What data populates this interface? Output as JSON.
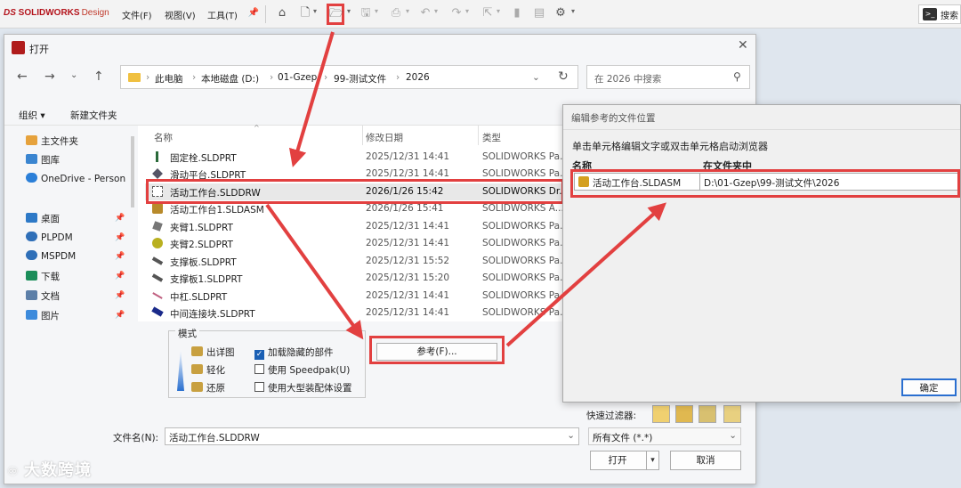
{
  "app": {
    "brand": "SOLIDWORKS",
    "brand_sub": "Design",
    "menus": [
      "文件(F)",
      "视图(V)",
      "工具(T)"
    ],
    "search_placeholder": "搜索"
  },
  "open_dialog": {
    "title": "打开",
    "path": [
      "此电脑",
      "本地磁盘 (D:)",
      "01-Gzep",
      "99-测试文件",
      "2026"
    ],
    "search_placeholder": "在 2026 中搜索",
    "toolbar": {
      "organize": "组织",
      "new_folder": "新建文件夹"
    },
    "nav_items": [
      "主文件夹",
      "图库",
      "OneDrive - Person",
      "桌面",
      "PLPDM",
      "MSPDM",
      "下载",
      "文档",
      "图片"
    ],
    "columns": {
      "name": "名称",
      "modified": "修改日期",
      "type": "类型"
    },
    "files": [
      {
        "name": "固定栓.SLDPRT",
        "date": "2025/12/31 14:41",
        "type": "SOLIDWORKS Pa..."
      },
      {
        "name": "滑动平台.SLDPRT",
        "date": "2025/12/31 14:41",
        "type": "SOLIDWORKS Pa..."
      },
      {
        "name": "活动工作台.SLDDRW",
        "date": "2026/1/26 15:42",
        "type": "SOLIDWORKS Dr..."
      },
      {
        "name": "活动工作台1.SLDASM",
        "date": "2026/1/26 15:41",
        "type": "SOLIDWORKS A..."
      },
      {
        "name": "夹臂1.SLDPRT",
        "date": "2025/12/31 14:41",
        "type": "SOLIDWORKS Pa..."
      },
      {
        "name": "夹臂2.SLDPRT",
        "date": "2025/12/31 14:41",
        "type": "SOLIDWORKS Pa..."
      },
      {
        "name": "支撑板.SLDPRT",
        "date": "2025/12/31 15:52",
        "type": "SOLIDWORKS Pa..."
      },
      {
        "name": "支撑板1.SLDPRT",
        "date": "2025/12/31 15:20",
        "type": "SOLIDWORKS Pa..."
      },
      {
        "name": "中杠.SLDPRT",
        "date": "2025/12/31 14:41",
        "type": "SOLIDWORKS Pa..."
      },
      {
        "name": "中间连接块.SLDPRT",
        "date": "2025/12/31 14:41",
        "type": "SOLIDWORKS Pa..."
      }
    ],
    "mode": {
      "title": "模式",
      "options": [
        "出详图",
        "轻化",
        "还原"
      ],
      "checkboxes": [
        "加载隐藏的部件",
        "使用 Speedpak(U)",
        "使用大型装配体设置"
      ],
      "checked": [
        true,
        false,
        false
      ]
    },
    "references_button": "参考(F)...",
    "quick_filter_label": "快速过滤器:",
    "filename_label": "文件名(N):",
    "filename_value": "活动工作台.SLDDRW",
    "filetype_value": "所有文件 (*.*)",
    "open_button": "打开",
    "cancel_button": "取消"
  },
  "ref_dialog": {
    "title": "编辑参考的文件位置",
    "instruction": "单击单元格编辑文字或双击单元格启动浏览器",
    "col_name": "名称",
    "col_folder": "在文件夹中",
    "row": {
      "name": "活动工作台.SLDASM",
      "folder": "D:\\01-Gzep\\99-测试文件\\2026"
    },
    "ok_button": "确定"
  },
  "watermark": "大数跨境",
  "colors": {
    "highlight": "#e24040",
    "sw_red": "#b4141c"
  }
}
